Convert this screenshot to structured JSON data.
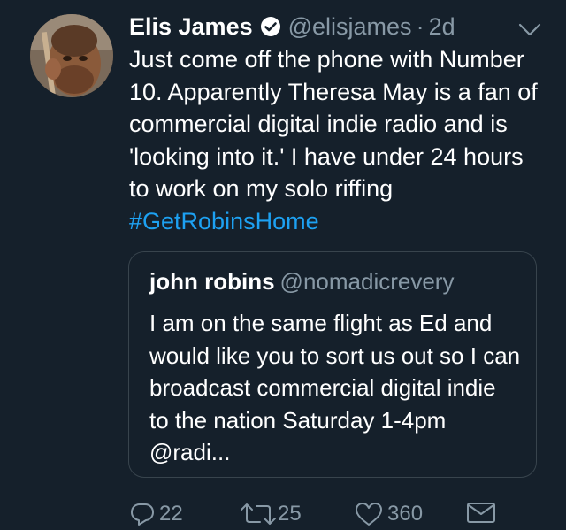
{
  "tweet": {
    "author_name": "Elis James",
    "handle": "@elisjames",
    "separator": "·",
    "time": "2d",
    "text": "Just come off the phone with Number 10. Apparently Theresa May is a fan of commercial digital indie radio and is 'looking into it.' I have under 24 hours to work on my solo riffing ",
    "hashtag": "#GetRobinsHome",
    "verified": true
  },
  "quoted_tweet": {
    "author_name": "john robins",
    "handle": "@nomadicrevery",
    "text": "I am on the same flight as Ed and would like you to sort us out so I can broadcast commercial digital indie to the nation Saturday 1-4pm @radi..."
  },
  "actions": {
    "reply_count": "22",
    "retweet_count": "25",
    "like_count": "360"
  },
  "icons": {
    "verified": "verified-badge-icon",
    "caret": "chevron-down-icon",
    "reply": "reply-icon",
    "retweet": "retweet-icon",
    "like": "heart-icon",
    "dm": "envelope-icon"
  },
  "colors": {
    "background": "#15202b",
    "text": "#ffffff",
    "secondary": "#8899a6",
    "link": "#1da1f2",
    "border": "#38444d"
  }
}
